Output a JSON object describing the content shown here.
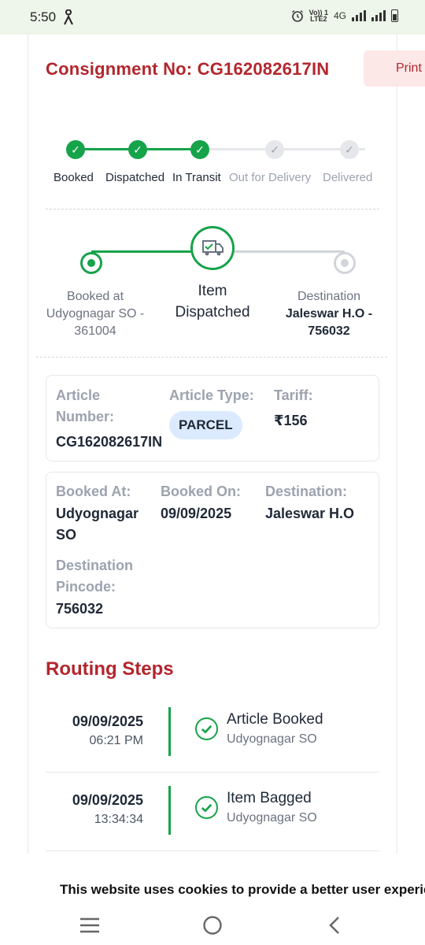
{
  "status_bar": {
    "time": "5:50",
    "network": "4G",
    "volte_line1": "Vo)) 1",
    "volte_line2": "LTE2"
  },
  "header": {
    "consignment_label": "Consignment No: CG162082617IN",
    "print_label": "Print"
  },
  "progress": {
    "steps": [
      {
        "label": "Booked",
        "done": true
      },
      {
        "label": "Dispatched",
        "done": true
      },
      {
        "label": "In Transit",
        "done": true
      },
      {
        "label": "Out for Delivery",
        "done": false
      },
      {
        "label": "Delivered",
        "done": false
      }
    ]
  },
  "route": {
    "origin_line1": "Booked at",
    "origin_line2": "Udyognagar SO -",
    "origin_line3": "361004",
    "current_line1": "Item",
    "current_line2": "Dispatched",
    "dest_line1": "Destination",
    "dest_line2": "Jaleswar H.O -",
    "dest_line3": "756032"
  },
  "article": {
    "number_label_1": "Article",
    "number_label_2": "Number:",
    "number_value": "CG162082617IN",
    "type_label": "Article Type:",
    "type_value": "PARCEL",
    "tariff_label": "Tariff:",
    "tariff_value": "₹156"
  },
  "booking": {
    "booked_at_label": "Booked At:",
    "booked_at_value_1": "Udyognagar",
    "booked_at_value_2": "SO",
    "booked_on_label": "Booked On:",
    "booked_on_value": "09/09/2025",
    "destination_label": "Destination:",
    "destination_value": "Jaleswar H.O",
    "pincode_label_1": "Destination",
    "pincode_label_2": "Pincode:",
    "pincode_value": "756032"
  },
  "routing": {
    "title": "Routing Steps",
    "steps": [
      {
        "date": "09/09/2025",
        "time": "06:21 PM",
        "event": "Article Booked",
        "location": "Udyognagar SO"
      },
      {
        "date": "09/09/2025",
        "time": "13:34:34",
        "event": "Item Bagged",
        "location": "Udyognagar SO"
      }
    ]
  },
  "cookie": {
    "text": "This website uses cookies to provide a better user experience"
  },
  "colors": {
    "brand_red": "#b3262d",
    "success_green": "#16a34a",
    "muted_gray": "#9ca3af"
  },
  "icons": [
    "person-icon",
    "alarm-icon",
    "signal-icon",
    "battery-icon",
    "check-icon",
    "truck-icon",
    "menu-icon",
    "home-icon",
    "back-icon"
  ]
}
